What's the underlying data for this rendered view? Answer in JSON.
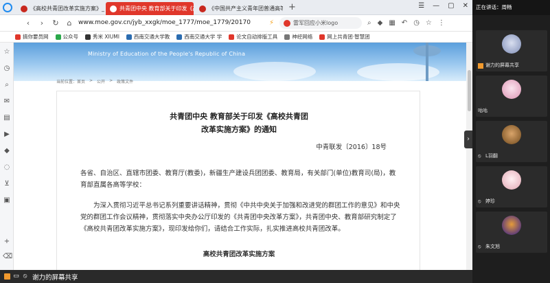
{
  "browser": {
    "tabs": [
      {
        "label": "《高校共青团改革实施方案》_百度"
      },
      {
        "label": "共青团中央 教育部关于印发《高校共"
      },
      {
        "label": "《中国共产主义青年团普通高等学校"
      }
    ],
    "new_tab": "+",
    "url": "www.moe.gov.cn/jyb_xxgk/moe_1777/moe_1779/20170",
    "search_text": "雷军回应小米logo",
    "bookmarks": [
      {
        "label": "搞你要员网",
        "color": "#e0372b"
      },
      {
        "label": "公众号",
        "color": "#2aa84a"
      },
      {
        "label": "秀米 XIUMI",
        "color": "#333333"
      },
      {
        "label": "西南交通大学教",
        "color": "#2b6cb0"
      },
      {
        "label": "西南交通大学 学",
        "color": "#2b6cb0"
      },
      {
        "label": "论文自动排版工具",
        "color": "#e0372b"
      },
      {
        "label": "神经网络",
        "color": "#777777"
      },
      {
        "label": "网上共青团·智慧团",
        "color": "#e0372b"
      }
    ]
  },
  "page": {
    "banner_title": "Ministry of Education of the People's Republic of China",
    "breadcrumb": [
      "当前位置：首页",
      ">",
      "公开",
      ">",
      "政策文件"
    ],
    "doc": {
      "title_line1": "共青团中央 教育部关于印发《高校共青团",
      "title_line2": "改革实施方案》的通知",
      "number": "中青联发〔2016〕18号",
      "paragraph1": "各省、自治区、直辖市团委、教育厅(教委)，新疆生产建设兵团团委、教育局，有关部门(单位)教育司(局)，教育部直属各高等学校：",
      "paragraph2": "为深入贯彻习近平总书记系列重要讲话精神，贯彻《中共中央关于加强和改进党的群团工作的意见》和中央党的群团工作会议精神，贯彻落实中央办公厅印发的《共青团中央改革方案》，共青团中央、教育部研究制定了《高校共青团改革实施方案》，现印发给你们，请结合工作实际，扎实推进高校共青团改革。",
      "subtitle": "高校共青团改革实施方案"
    }
  },
  "share_bar": {
    "label": "谢力的屏幕共享"
  },
  "meeting": {
    "speaking_prefix": "正在讲话：",
    "speaking_name": "周畅",
    "participants": [
      {
        "name": "谢力的屏幕共享"
      },
      {
        "name": "咕咕"
      },
      {
        "name": "L羽翻"
      },
      {
        "name": "婷珍"
      },
      {
        "name": "朱文旭"
      }
    ]
  },
  "colors": {
    "active_tab": "#e0372b",
    "banner": "#5b9fdc",
    "panel_bg": "#1e1e1e",
    "share_icon": "#f29a2e"
  }
}
